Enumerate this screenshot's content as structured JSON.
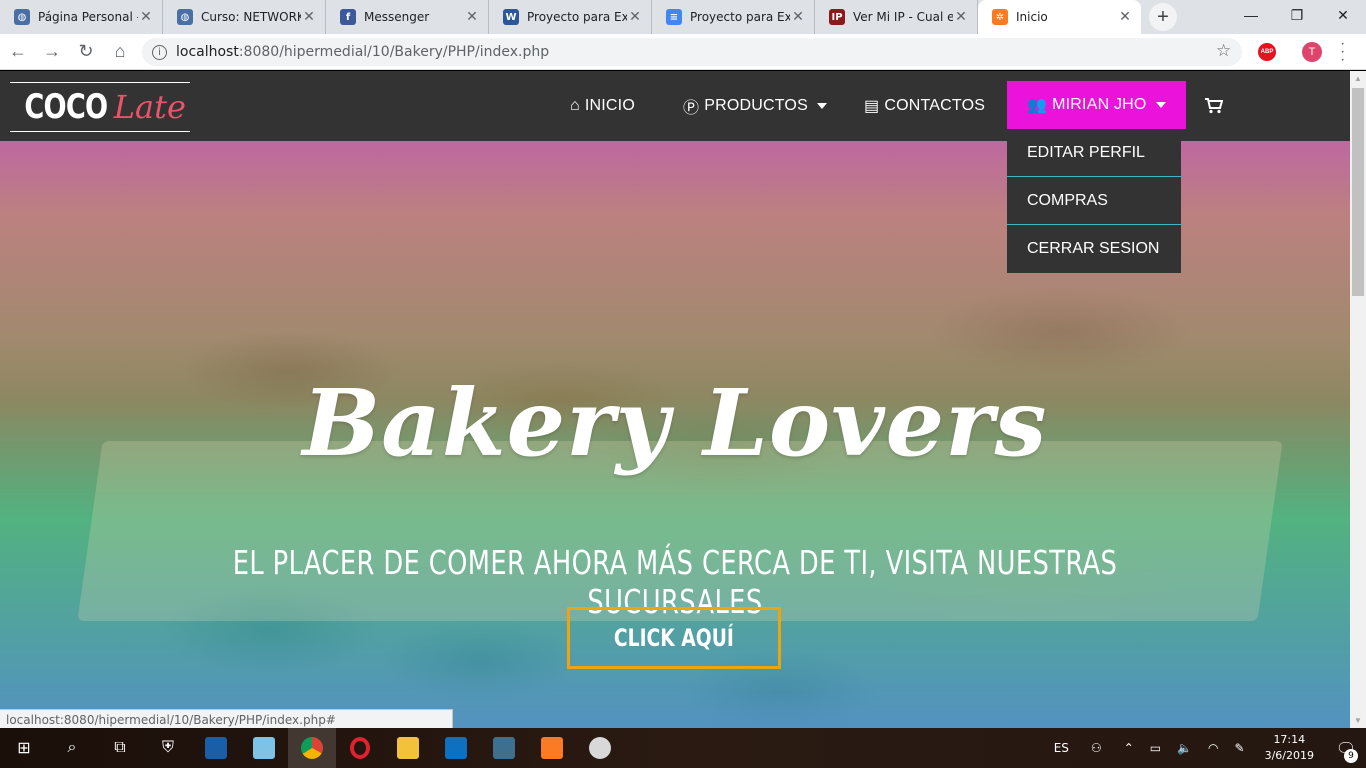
{
  "browser": {
    "tabs": [
      {
        "title": "Página Personal - U",
        "icon": "globe-icon",
        "color": "#4a6fa5"
      },
      {
        "title": "Curso: NETWORKIN",
        "icon": "globe-icon",
        "color": "#4a6fa5"
      },
      {
        "title": "Messenger",
        "icon": "facebook-icon",
        "color": "#3b5998"
      },
      {
        "title": "Proyecto para Exam",
        "icon": "word-icon",
        "color": "#2b579a"
      },
      {
        "title": "Proyecto para Exam",
        "icon": "docs-icon",
        "color": "#4285f4"
      },
      {
        "title": "Ver Mi IP - Cual es",
        "icon": "ip-icon",
        "color": "#8b1a1a"
      },
      {
        "title": "Inicio",
        "icon": "xampp-icon",
        "color": "#fb7a24"
      }
    ],
    "new_tab": "+",
    "window_controls": {
      "minimize": "—",
      "maximize": "❐",
      "close": "✕"
    },
    "address": {
      "host": "localhost",
      "path": ":8080/hipermedial/10/Bakery/PHP/index.php"
    },
    "extension": "ABP",
    "profile_initial": "T",
    "status_url": "localhost:8080/hipermedial/10/Bakery/PHP/index.php#"
  },
  "site": {
    "logo": {
      "coco": "COCO",
      "late": "Late"
    },
    "nav": {
      "inicio": "INICIO",
      "productos": "PRODUCTOS",
      "contactos": "CONTACTOS",
      "user": "MIRIAN JHO"
    },
    "user_menu": [
      "EDITAR PERFIL",
      "COMPRAS",
      "CERRAR SESION"
    ],
    "hero": {
      "headline": "Bakery Lovers",
      "subline": "EL PLACER DE COMER AHORA MÁS CERCA DE TI, VISITA NUESTRAS SUCURSALES",
      "cta": "CLICK AQUÍ"
    },
    "colors": {
      "nav_bg": "#333333",
      "user_accent": "#eb12dc",
      "cta_border": "#f0a30a",
      "dropdown_divider": "#3fb8c6"
    }
  },
  "taskbar": {
    "language": "ES",
    "time": "17:14",
    "date": "3/6/2019",
    "notifications": "9"
  }
}
